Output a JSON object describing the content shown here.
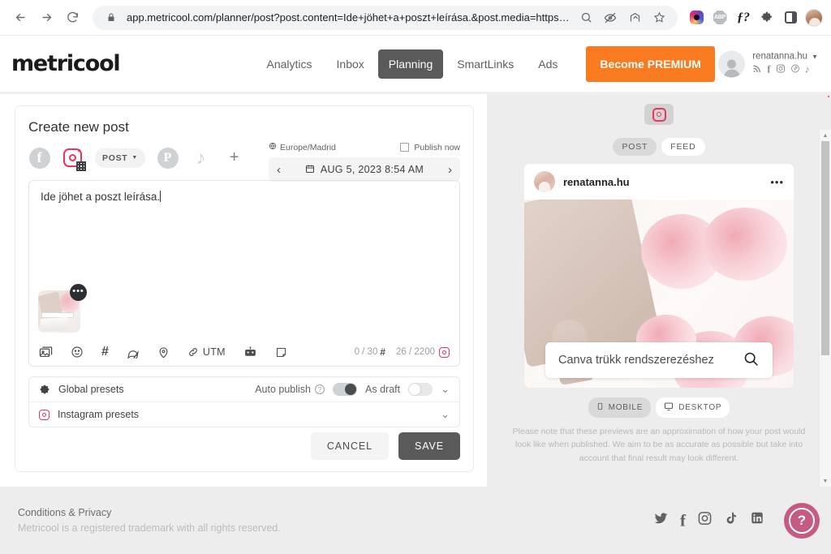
{
  "browser": {
    "url": "app.metricool.com/planner/post?post.content=Ide+jöhet+a+poszt+leírása.&post.media=https%3A%2...",
    "back_icon": "back-arrow-icon",
    "forward_icon": "forward-arrow-icon",
    "reload_icon": "reload-icon",
    "lock_icon": "lock-icon",
    "extensions": [
      "zoom-icon",
      "eye-off-icon",
      "share-icon",
      "bookmark-star-icon",
      "instagram-extension-icon",
      "adblock-plus-icon",
      "fonts-ninja-icon",
      "puzzle-extensions-icon",
      "side-panel-icon",
      "profile-avatar-icon"
    ]
  },
  "header": {
    "logo": "metricool",
    "nav": [
      {
        "label": "Analytics",
        "active": false
      },
      {
        "label": "Inbox",
        "active": false
      },
      {
        "label": "Planning",
        "active": true
      },
      {
        "label": "SmartLinks",
        "active": false
      },
      {
        "label": "Ads",
        "active": false
      }
    ],
    "premium_label": "Become PREMIUM",
    "premium_color": "#f97a1f",
    "account_name": "renatanna.hu",
    "account_socials": [
      "rss-icon",
      "facebook-icon",
      "instagram-icon",
      "pinterest-icon",
      "tiktok-icon"
    ]
  },
  "editor": {
    "title": "Create new post",
    "platforms": [
      {
        "name": "facebook-icon",
        "selected": false
      },
      {
        "name": "instagram-icon",
        "selected": true
      },
      {
        "name": "pinterest-icon",
        "selected": false
      },
      {
        "name": "tiktok-icon",
        "selected": false
      },
      {
        "name": "add-network-icon",
        "selected": false
      }
    ],
    "post_type_label": "POST",
    "timezone": "Europe/Madrid",
    "publish_now_label": "Publish now",
    "publish_now_checked": false,
    "scheduled_date": "AUG 5, 2023 8:54 AM",
    "content": "Ide jöhet a poszt leírása.",
    "tools": [
      "media-icon",
      "emoji-icon",
      "hashtag-icon",
      "comment-icon",
      "location-icon",
      "utm-icon",
      "robot-icon",
      "note-icon"
    ],
    "utm_label": "UTM",
    "hashtag_counter": "0 / 30",
    "char_counter": "26 / 2200",
    "presets": [
      {
        "label": "Global presets",
        "icon": "gear-icon"
      },
      {
        "label": "Instagram presets",
        "icon": "instagram-icon"
      }
    ],
    "auto_publish_label": "Auto publish",
    "auto_publish_on": true,
    "as_draft_label": "As draft",
    "as_draft_on": false,
    "cancel_label": "CANCEL",
    "save_label": "SAVE"
  },
  "preview": {
    "network_icon": "instagram-icon",
    "view_tabs": [
      {
        "label": "POST",
        "active": true
      },
      {
        "label": "FEED",
        "active": false
      }
    ],
    "account_name": "renatanna.hu",
    "overlay_text": "Canva trükk rendszerezéshez",
    "device_tabs": [
      {
        "label": "MOBILE",
        "active": true,
        "icon": "mobile-icon"
      },
      {
        "label": "DESKTOP",
        "active": false,
        "icon": "desktop-icon"
      }
    ],
    "disclaimer": "Please note that these previews are an approximation of how your post would look like when published. We aim to be as accurate as possible but take into account that final result may look different."
  },
  "footer": {
    "link": "Conditions & Privacy",
    "note": "Metricool is a registered trademark with all rights reserved.",
    "socials": [
      "twitter-icon",
      "facebook-icon",
      "instagram-icon",
      "tiktok-icon",
      "linkedin-icon"
    ],
    "help_label": "?",
    "help_color": "#c65a82"
  }
}
